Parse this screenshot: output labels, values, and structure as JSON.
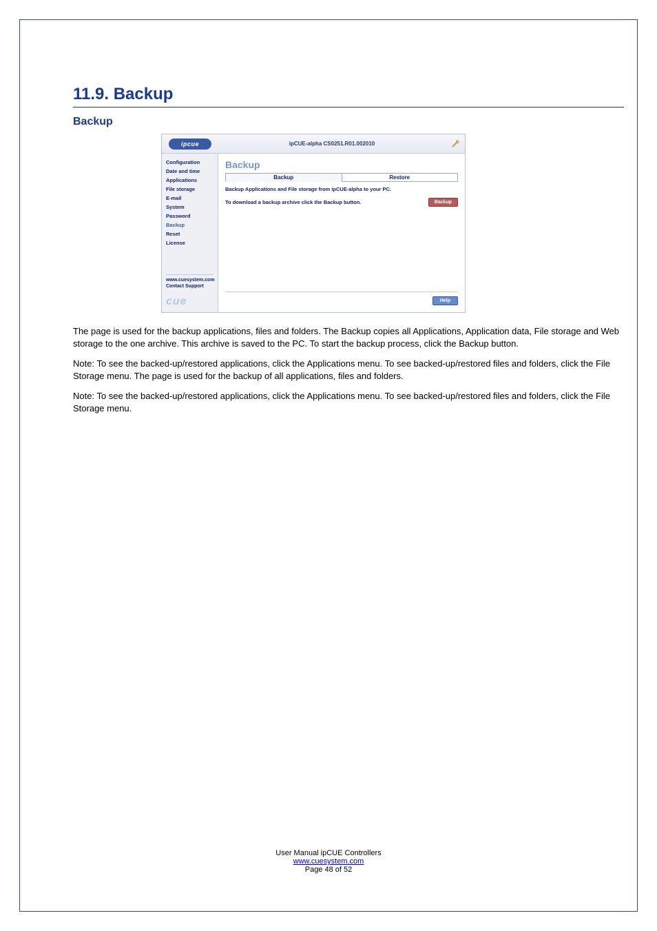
{
  "heading": "11.9.   Backup",
  "subheading": "Backup",
  "screenshot": {
    "logo_text": "ipcue",
    "header_title": "ipCUE-alpha   CS0251.R01.002010",
    "sidebar": {
      "items": [
        {
          "label": "Configuration"
        },
        {
          "label": "Date and time"
        },
        {
          "label": "Applications"
        },
        {
          "label": "File storage"
        },
        {
          "label": "E-mail"
        },
        {
          "label": "System"
        },
        {
          "label": "Password"
        },
        {
          "label": "Backup",
          "active": true
        },
        {
          "label": "Reset"
        },
        {
          "label": "License"
        }
      ],
      "link1": "www.cuesystem.com",
      "link2": "Contact Support",
      "brand": "cue"
    },
    "main": {
      "title": "Backup",
      "tabs": [
        {
          "label": "Backup",
          "active": true
        },
        {
          "label": "Restore"
        }
      ],
      "desc": "Backup Applications and File storage from ipCUE-alpha to your PC.",
      "row_text": "To download a backup archive click the Backup button.",
      "backup_btn": "Backup",
      "help_btn": "Help"
    }
  },
  "paragraphs": [
    "The page is used for the backup applications, files and folders. The Backup copies all Applications, Application data, File storage and Web storage to the one archive. This archive is saved to the PC. To start the backup process, click the Backup button.",
    "Note: To see the backed-up/restored applications, click the Applications menu. To see backed-up/restored files and folders, click the File Storage menu. The page is used for the backup of all applications, files and folders.",
    "Note: To see the backed-up/restored applications, click the Applications menu. To see backed-up/restored files and folders, click the File Storage menu."
  ],
  "footer": {
    "line1": "User Manual ipCUE Controllers",
    "link": "www.cuesystem.com",
    "line3": "Page 48 of 52"
  }
}
